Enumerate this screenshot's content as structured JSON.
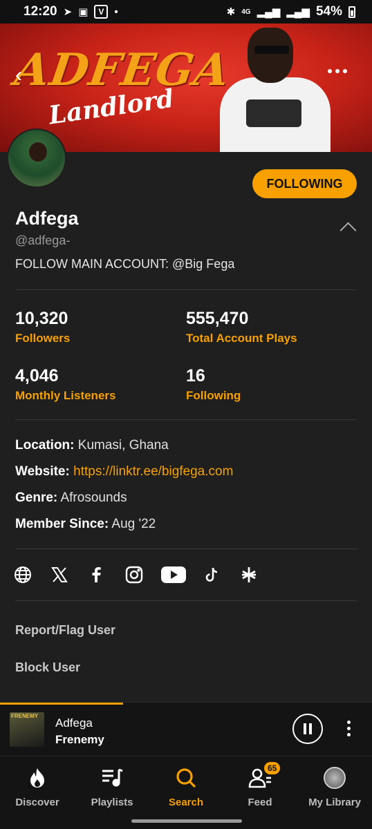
{
  "status_bar": {
    "time": "12:20",
    "battery": "54%",
    "network": "4G"
  },
  "banner": {
    "title": "ADFEGA",
    "subtitle": "Landlord"
  },
  "profile": {
    "follow_label": "FOLLOWING",
    "name": "Adfega",
    "handle": "@adfega-",
    "bio": "FOLLOW MAIN ACCOUNT: @Big Fega"
  },
  "stats": [
    {
      "value": "10,320",
      "label": "Followers"
    },
    {
      "value": "555,470",
      "label": "Total Account Plays"
    },
    {
      "value": "4,046",
      "label": "Monthly Listeners"
    },
    {
      "value": "16",
      "label": "Following"
    }
  ],
  "info": {
    "location_label": "Location:",
    "location_value": "Kumasi, Ghana",
    "website_label": "Website:",
    "website_value": "https://linktr.ee/bigfega.com",
    "genre_label": "Genre:",
    "genre_value": "Afrosounds",
    "member_label": "Member Since:",
    "member_value": "Aug '22"
  },
  "socials": [
    "globe-icon",
    "x-icon",
    "facebook-icon",
    "instagram-icon",
    "youtube-icon",
    "tiktok-icon",
    "linktree-icon"
  ],
  "actions": {
    "report": "Report/Flag User",
    "block": "Block User"
  },
  "mini_player": {
    "art_text": "FRENEMY",
    "artist": "Adfega",
    "title": "Frenemy",
    "progress": 0.33
  },
  "nav": {
    "items": [
      {
        "label": "Discover",
        "icon": "flame-icon"
      },
      {
        "label": "Playlists",
        "icon": "playlist-icon"
      },
      {
        "label": "Search",
        "icon": "search-icon",
        "active": true
      },
      {
        "label": "Feed",
        "icon": "feed-icon",
        "badge": "65"
      },
      {
        "label": "My Library",
        "icon": "library-avatar-icon"
      }
    ]
  },
  "colors": {
    "accent": "#f7a000",
    "background": "#1f1f1f",
    "banner": "#c92318"
  }
}
